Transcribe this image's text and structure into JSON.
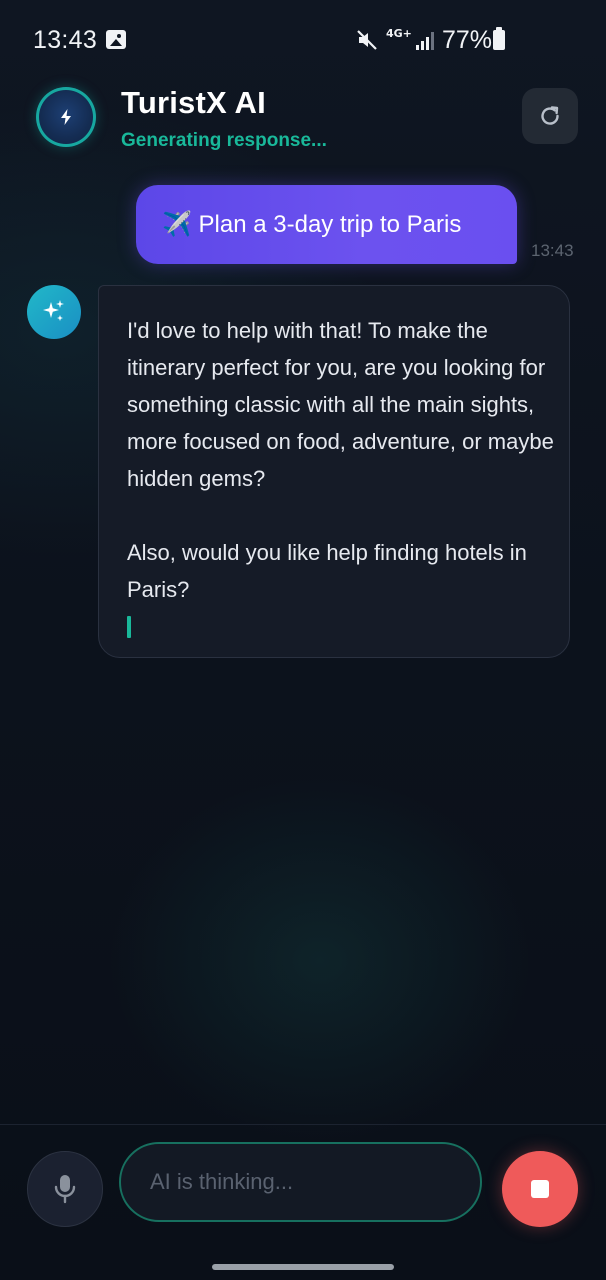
{
  "status_bar": {
    "time": "13:43",
    "network": "4G+",
    "battery": "77%"
  },
  "header": {
    "title": "TuristX AI",
    "status": "Generating response..."
  },
  "messages": [
    {
      "role": "user",
      "icon": "airplane-emoji",
      "text": "✈️ Plan a 3-day trip to Paris",
      "time": "13:43"
    },
    {
      "role": "assistant",
      "icon": "sparkles-icon",
      "paragraphs": [
        "I'd love to help with that! To make the itinerary perfect for you, are you looking for something classic with all the main sights, more focused on food, adventure, or maybe hidden gems?",
        "Also, would you like help finding hotels in Paris?"
      ]
    }
  ],
  "composer": {
    "placeholder": "AI is thinking...",
    "value": ""
  },
  "colors": {
    "accent_teal": "#19b89a",
    "user_bubble": "#6c52ef",
    "stop_button": "#ef5a5a",
    "background": "#0c121c"
  }
}
